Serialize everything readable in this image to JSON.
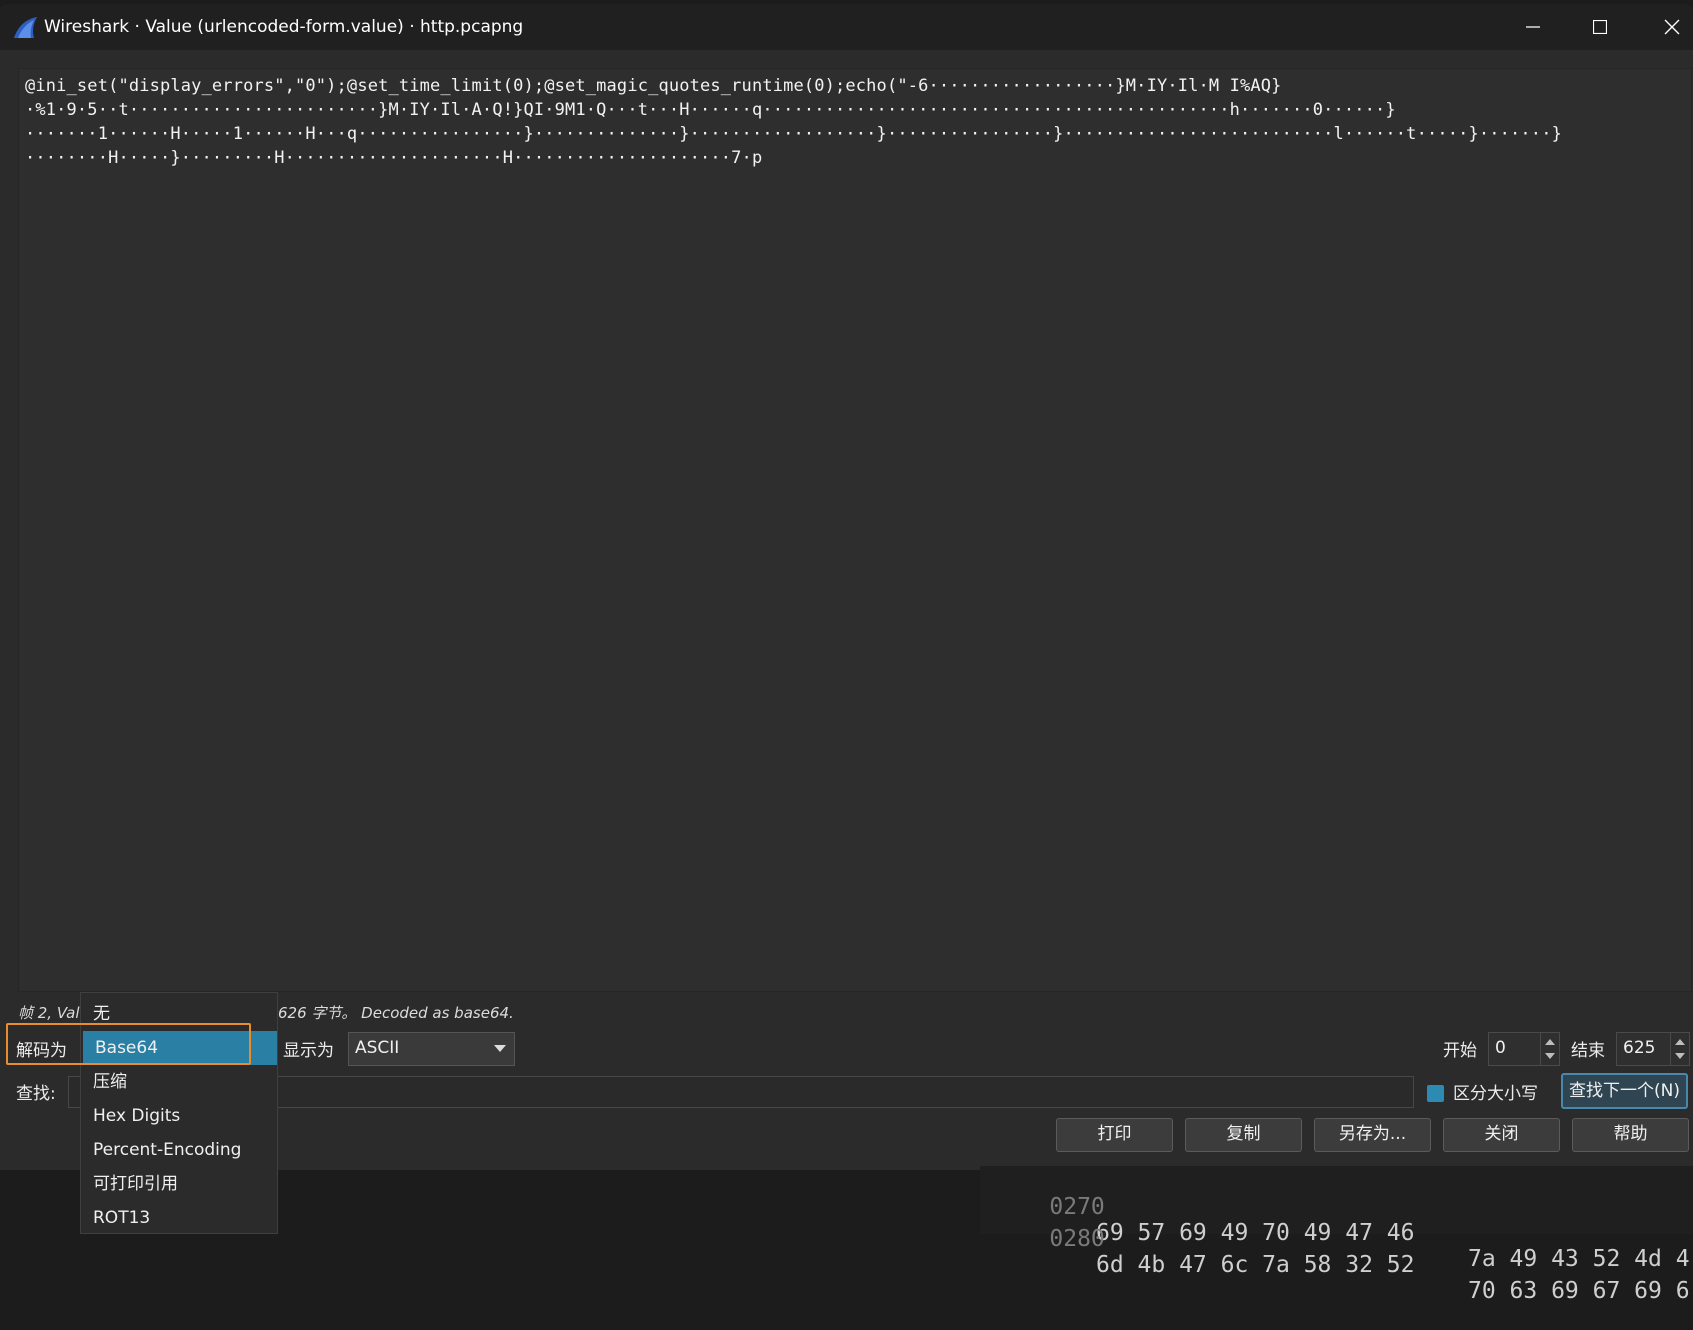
{
  "window": {
    "title": "Wireshark · Value (urlencoded-form.value) · http.pcapng",
    "brand_color": "#2e5fbf"
  },
  "content": {
    "lines": [
      "@ini_set(\"display_errors\",\"0\");@set_time_limit(0);@set_magic_quotes_runtime(0);echo(\"-6··················}M·IY·Il·M I%AQ}",
      "·%1·9·5··t························}M·IY·Il·A·Q!}QI·9M1·Q···t···H······q·············································h·······0······}",
      "·······1······H·····1······H···q················}··············}··················}················}··························l······t·····}·······}",
      "········H·····}·········H·····················H·····················7·p"
    ]
  },
  "status": {
    "left": "帧 2, Valu",
    "right": "626 字节。 Decoded as base64."
  },
  "controls": {
    "decode_label": "解码为",
    "decode_selected": "Base64",
    "show_label": "显示为",
    "show_value": "ASCII",
    "start_label": "开始",
    "start_value": "0",
    "end_label": "结束",
    "end_value": "625",
    "find_label": "查找:",
    "find_value": "",
    "case_label": "区分大小写",
    "case_checked": true,
    "find_next_label": "查找下一个(N)"
  },
  "decode_options": [
    "无",
    "Base64",
    "压缩",
    "Hex Digits",
    "Percent-Encoding",
    "可打印引用",
    "ROT13"
  ],
  "buttons": {
    "print": "打印",
    "copy": "复制",
    "save_as": "另存为...",
    "close": "关闭",
    "help": "帮助"
  },
  "hex_background": {
    "rows": [
      {
        "offset": "0270",
        "bytes_a": "69 57 69 49 70 49 47 46",
        "bytes_b": "7a 49 43 52 4d 4"
      },
      {
        "offset": "0280",
        "bytes_a": "6d 4b 47 6c 7a 58 32 52",
        "bytes_b": "70 63 69 67 69 6"
      }
    ]
  }
}
